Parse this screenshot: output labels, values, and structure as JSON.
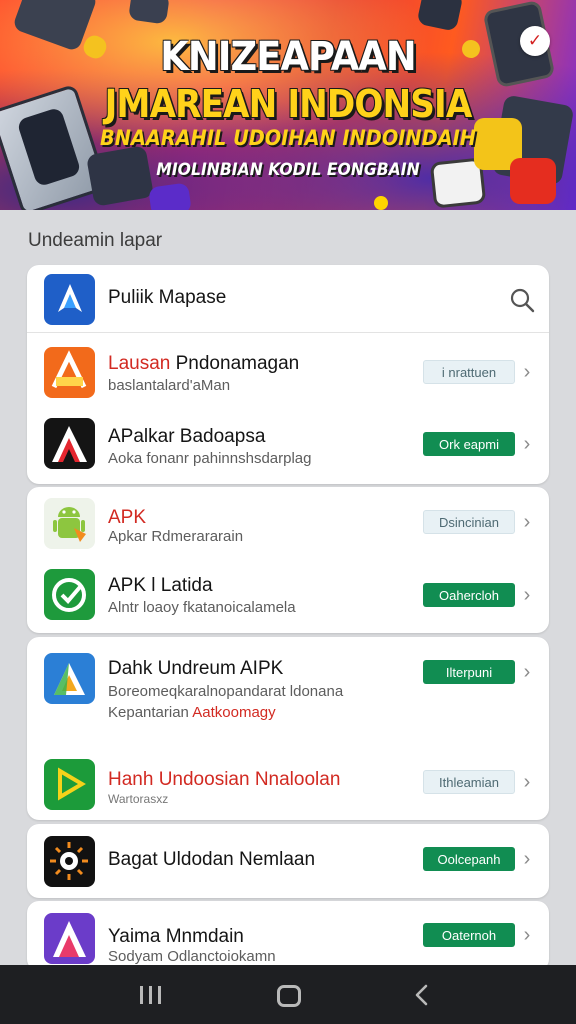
{
  "banner": {
    "line1": "KNIZEAPAAN",
    "line2": "JMAREAN INDONSIA",
    "line3": "BNAARAHIL UDOIHAN INDOINDAIH",
    "line4": "MIOLINBIAN KODIL EONGBAIN",
    "badge_icon": "red-swoosh-icon"
  },
  "section": {
    "title": "Undeamin lapar"
  },
  "search": {
    "label": "Puliik Mapase",
    "icon": "search-icon"
  },
  "apps": [
    {
      "title": "Lausan Pndonamagan",
      "title_accent": "Lausan",
      "subtitle": "baslantalard'aMan",
      "button": "i nrattuen",
      "button_style": "light",
      "icon": "orange-app-store-icon",
      "accent": "#f26a1b"
    },
    {
      "title": "APalkar  Badoapsa",
      "subtitle": "Aoka fonanr  pahinnshsdarplag",
      "button": "Ork eapmi",
      "button_style": "green",
      "icon": "red-a-logo-icon",
      "accent": "#e4262f"
    },
    {
      "title": "APK",
      "subtitle": "Apkar  Rdmerararain",
      "button": "Dsincinian",
      "button_style": "light",
      "icon": "android-robot-icon",
      "accent": "#8dc63f"
    },
    {
      "title": "APK l Latida",
      "subtitle": "Alntr  loaoy fkatanoicalamela",
      "button": "Oahercloh",
      "button_style": "green",
      "icon": "green-shield-icon",
      "accent": "#1e9a3c"
    },
    {
      "title": "Dahk Undreum AIPK",
      "subtitle": "Boreomeqkaralnopandarat ldonana",
      "subtitle2": "Kepantarian",
      "subtitle2_accent": "Aatkoomagy",
      "button": "Ilterpuni",
      "button_style": "green",
      "icon": "blue-triangle-icon",
      "accent": "#2b7fd6"
    },
    {
      "title": "Hanh Undoosian Nnaloolan",
      "subtitle": "Wartorasxz",
      "button": "Ithleamian",
      "button_style": "light",
      "icon": "green-play-icon",
      "accent": "#1c9b3a"
    },
    {
      "title": "Bagat Uldodan Nemlaan",
      "button": "Oolcepanh",
      "button_style": "green",
      "icon": "sun-burst-icon",
      "accent": "#111111"
    },
    {
      "title": "Yaima Mnmdain",
      "subtitle": "Sodyam Odlanctoiokamn",
      "button": "Oaternoh",
      "button_style": "green",
      "icon": "purple-a-icon",
      "accent": "#6b3cc9"
    }
  ],
  "navbar": {
    "recent": "recent-apps-icon",
    "home": "home-icon",
    "back": "back-icon"
  },
  "colors": {
    "green_pill": "#118d52",
    "light_pill": "#e8f1f5",
    "red_text": "#d22a22",
    "background": "#d9dadd"
  }
}
